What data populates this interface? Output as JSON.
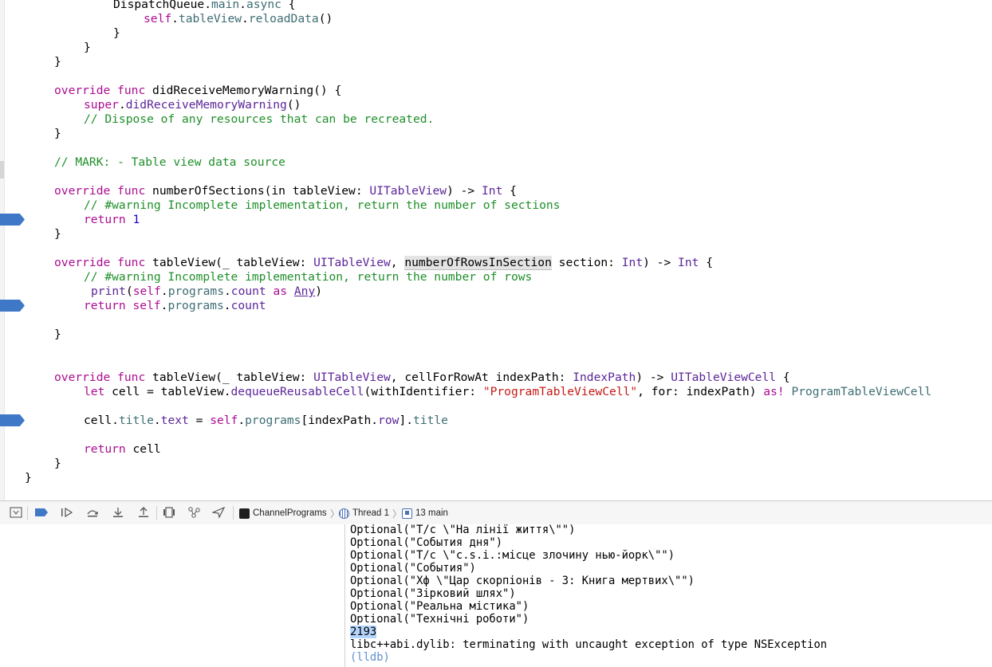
{
  "editor": {
    "lines": [
      "DispatchQueue.main.async {",
      "self.tableView.reloadData()",
      "}",
      "}",
      "}",
      "override func didReceiveMemoryWarning() {",
      "super.didReceiveMemoryWarning()",
      "// Dispose of any resources that can be recreated.",
      "}",
      "// MARK: - Table view data source",
      "override func numberOfSections(in tableView: UITableView) -> Int {",
      "// #warning Incomplete implementation, return the number of sections",
      "return 1",
      "}",
      "override func tableView(_ tableView: UITableView, numberOfRowsInSection section: Int) -> Int {",
      "// #warning Incomplete implementation, return the number of rows",
      "print(self.programs.count as Any)",
      "return self.programs.count",
      "}",
      "override func tableView(_ tableView: UITableView, cellForRowAt indexPath: IndexPath) -> UITableViewCell {",
      "let cell = tableView.dequeueReusableCell(withIdentifier: \"ProgramTableViewCell\", for: indexPath) as! ProgramTableViewCell",
      "cell.title.text = self.programs[indexPath.row].title",
      "return cell",
      "}",
      "}"
    ],
    "breakpoint_lines": [
      13,
      18,
      22
    ]
  },
  "debugbar": {
    "scheme": "ChannelPrograms",
    "thread": "Thread 1",
    "frame": "13 main",
    "icons": [
      "hide-debug-area-icon",
      "breakpoints-toggle-icon",
      "continue-icon",
      "step-over-icon",
      "step-into-icon",
      "step-out-icon",
      "view-debugger-icon",
      "memory-graph-icon",
      "simulate-location-icon"
    ]
  },
  "console": {
    "lines": [
      "Optional(\"Т/с \\\"На лінії життя\\\"\")",
      "Optional(\"События дня\")",
      "Optional(\"Т/с \\\"c.s.i.:місце злочину нью-йорк\\\"\")",
      "Optional(\"События\")",
      "Optional(\"Хф \\\"Цар скорпіонів - 3: Книга мертвих\\\"\")",
      "Optional(\"Зірковий шлях\")",
      "Optional(\"Реальна містика\")",
      "Optional(\"Технічні роботи\")",
      "2193",
      "libc++abi.dylib: terminating with uncaught exception of type NSException"
    ],
    "prompt": "(lldb)"
  },
  "colors": {
    "keyword": "#ab0d91",
    "type": "#5c2699",
    "comment": "#1f8f2a",
    "string": "#c41a16",
    "number": "#1c00cf",
    "breakpoint": "#3f78c6"
  }
}
